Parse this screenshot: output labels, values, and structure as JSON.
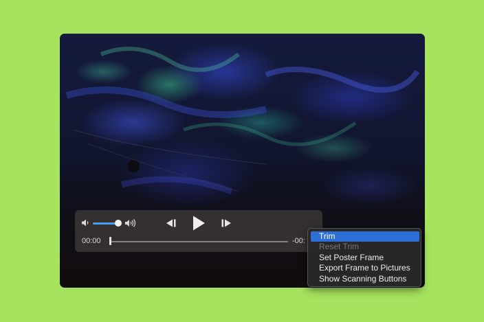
{
  "player": {
    "current_time": "00:00",
    "remaining_time": "-00:",
    "volume": 0.9,
    "progress": 0.0
  },
  "icons": {
    "volume_low": "speaker-low-icon",
    "volume_high": "speaker-high-icon",
    "rewind": "skip-back-icon",
    "play": "play-icon",
    "forward": "skip-forward-icon"
  },
  "context_menu": {
    "items": [
      {
        "label": "Trim",
        "state": "highlighted"
      },
      {
        "label": "Reset Trim",
        "state": "disabled"
      },
      {
        "label": "Set Poster Frame",
        "state": "enabled"
      },
      {
        "label": "Export Frame to Pictures",
        "state": "enabled"
      },
      {
        "label": "Show Scanning Buttons",
        "state": "enabled"
      }
    ]
  },
  "colors": {
    "background": "#a6e35f",
    "accent": "#4a9cf3",
    "menu_highlight": "#2e6fd6"
  }
}
